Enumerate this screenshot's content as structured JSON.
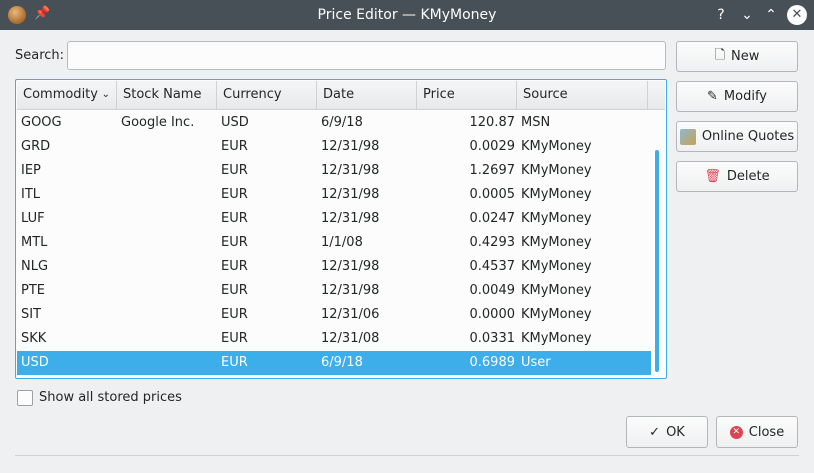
{
  "window": {
    "title": "Price Editor — KMyMoney",
    "help_glyph": "?",
    "minimize_glyph": "⌄",
    "maximize_glyph": "⌃",
    "close_glyph": "✕"
  },
  "search": {
    "label": "Search:",
    "value": "",
    "placeholder": ""
  },
  "buttons": {
    "new": "New",
    "modify": "Modify",
    "online_quotes": "Online Quotes",
    "delete": "Delete",
    "ok": "OK",
    "close": "Close"
  },
  "table": {
    "columns": [
      "Commodity",
      "Stock Name",
      "Currency",
      "Date",
      "Price",
      "Source"
    ],
    "rows": [
      {
        "commodity": "GOOG",
        "stock_name": "Google Inc.",
        "currency": "USD",
        "date": "6/9/18",
        "price": "120.87",
        "source": "MSN"
      },
      {
        "commodity": "GRD",
        "stock_name": "",
        "currency": "EUR",
        "date": "12/31/98",
        "price": "0.0029",
        "source": "KMyMoney"
      },
      {
        "commodity": "IEP",
        "stock_name": "",
        "currency": "EUR",
        "date": "12/31/98",
        "price": "1.2697",
        "source": "KMyMoney"
      },
      {
        "commodity": "ITL",
        "stock_name": "",
        "currency": "EUR",
        "date": "12/31/98",
        "price": "0.0005",
        "source": "KMyMoney"
      },
      {
        "commodity": "LUF",
        "stock_name": "",
        "currency": "EUR",
        "date": "12/31/98",
        "price": "0.0247",
        "source": "KMyMoney"
      },
      {
        "commodity": "MTL",
        "stock_name": "",
        "currency": "EUR",
        "date": "1/1/08",
        "price": "0.4293",
        "source": "KMyMoney"
      },
      {
        "commodity": "NLG",
        "stock_name": "",
        "currency": "EUR",
        "date": "12/31/98",
        "price": "0.4537",
        "source": "KMyMoney"
      },
      {
        "commodity": "PTE",
        "stock_name": "",
        "currency": "EUR",
        "date": "12/31/98",
        "price": "0.0049",
        "source": "KMyMoney"
      },
      {
        "commodity": "SIT",
        "stock_name": "",
        "currency": "EUR",
        "date": "12/31/06",
        "price": "0.0000",
        "source": "KMyMoney"
      },
      {
        "commodity": "SKK",
        "stock_name": "",
        "currency": "EUR",
        "date": "12/31/08",
        "price": "0.0331",
        "source": "KMyMoney"
      },
      {
        "commodity": "USD",
        "stock_name": "",
        "currency": "EUR",
        "date": "6/9/18",
        "price": "0.6989",
        "source": "User"
      }
    ],
    "selected_row": 10,
    "sort_indicator": "⌄"
  },
  "show_all": {
    "label": "Show all stored prices",
    "checked": false
  },
  "icons": {
    "app": "kmymoney-app-icon",
    "pin": "pin-icon",
    "new": "document-new-icon",
    "modify": "edit-pencil-icon",
    "online_quotes": "online-quotes-icon",
    "delete": "trash-icon",
    "ok": "checkmark-icon",
    "close": "close-circle-icon"
  },
  "colors": {
    "titlebar": "#475057",
    "selection": "#3daee9",
    "window_bg": "#eff0f1",
    "delete_icon": "#da4453",
    "close_icon": "#da4453"
  }
}
